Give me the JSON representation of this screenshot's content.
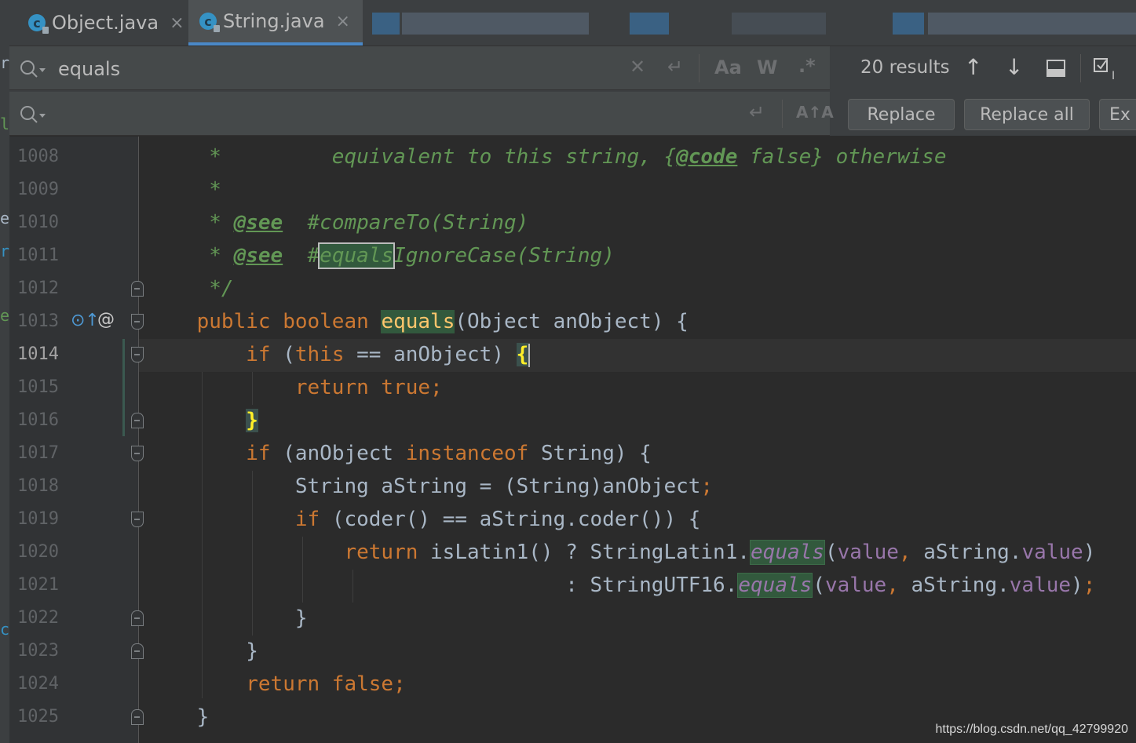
{
  "tabs": [
    {
      "label": "Object.java",
      "active": false
    },
    {
      "label": "String.java",
      "active": true
    }
  ],
  "search": {
    "query": "equals",
    "replace_value": "",
    "results": "20 results",
    "replace_label": "Replace",
    "replace_all_label": "Replace all",
    "exclude_label": "Ex",
    "match_case_label": "Aa",
    "words_label": "W",
    "regex_label": ".*",
    "preserve_case_label": "A↑A"
  },
  "colors": {
    "keyword": "#cc7832",
    "comment": "#629755",
    "field": "#9876aa",
    "match_highlight": "#32593d",
    "method_declaration": "#ffc66d",
    "brace_match": "#ffef28",
    "accent": "#4a88c7"
  },
  "editor": {
    "current_line": "1014",
    "lines": [
      {
        "num": "1008",
        "segments": [
          {
            "t": "     *         equivalent to this string, {",
            "c": "c"
          },
          {
            "t": "@code",
            "c": "tag"
          },
          {
            "t": " false} otherwise",
            "c": "c"
          }
        ]
      },
      {
        "num": "1009",
        "segments": [
          {
            "t": "     *",
            "c": "c"
          }
        ]
      },
      {
        "num": "1010",
        "segments": [
          {
            "t": "     * ",
            "c": "c"
          },
          {
            "t": "@see",
            "c": "tag"
          },
          {
            "t": "  #compareTo(String)",
            "c": "c"
          }
        ]
      },
      {
        "num": "1011",
        "segments": [
          {
            "t": "     * ",
            "c": "c"
          },
          {
            "t": "@see",
            "c": "tag"
          },
          {
            "t": "  #",
            "c": "c"
          },
          {
            "t": "equals",
            "c": "c hl-sel"
          },
          {
            "t": "IgnoreCase(String)",
            "c": "c"
          }
        ]
      },
      {
        "num": "1012",
        "segments": [
          {
            "t": "     */",
            "c": "c"
          }
        ]
      },
      {
        "num": "1013",
        "segments": [
          {
            "t": "    ",
            "c": ""
          },
          {
            "t": "public boolean ",
            "c": "k"
          },
          {
            "t": "equals",
            "c": "hl-fn"
          },
          {
            "t": "(Object anObject) {",
            "c": ""
          }
        ]
      },
      {
        "num": "1014",
        "segments": [
          {
            "t": "        ",
            "c": ""
          },
          {
            "t": "if ",
            "c": "k"
          },
          {
            "t": "(",
            "c": ""
          },
          {
            "t": "this ",
            "c": "k"
          },
          {
            "t": "== anObject) ",
            "c": ""
          },
          {
            "t": "{",
            "c": "brace-match"
          },
          {
            "t": "",
            "c": "caret"
          }
        ]
      },
      {
        "num": "1015",
        "segments": [
          {
            "t": "            ",
            "c": ""
          },
          {
            "t": "return true;",
            "c": "k"
          }
        ]
      },
      {
        "num": "1016",
        "segments": [
          {
            "t": "        ",
            "c": ""
          },
          {
            "t": "}",
            "c": "brace-match"
          }
        ]
      },
      {
        "num": "1017",
        "segments": [
          {
            "t": "        ",
            "c": ""
          },
          {
            "t": "if ",
            "c": "k"
          },
          {
            "t": "(anObject ",
            "c": ""
          },
          {
            "t": "instanceof ",
            "c": "k"
          },
          {
            "t": "String) {",
            "c": ""
          }
        ]
      },
      {
        "num": "1018",
        "segments": [
          {
            "t": "            String aString = (String)anObject",
            "c": ""
          },
          {
            "t": ";",
            "c": "k"
          }
        ]
      },
      {
        "num": "1019",
        "segments": [
          {
            "t": "            ",
            "c": ""
          },
          {
            "t": "if ",
            "c": "k"
          },
          {
            "t": "(coder() == aString.coder()) {",
            "c": ""
          }
        ]
      },
      {
        "num": "1020",
        "segments": [
          {
            "t": "                ",
            "c": ""
          },
          {
            "t": "return ",
            "c": "k"
          },
          {
            "t": "isLatin1() ? StringLatin1.",
            "c": ""
          },
          {
            "t": "equals",
            "c": "s hl"
          },
          {
            "t": "(",
            "c": ""
          },
          {
            "t": "value",
            "c": "f"
          },
          {
            "t": ", ",
            "c": "k"
          },
          {
            "t": "aString.",
            "c": ""
          },
          {
            "t": "value",
            "c": "f"
          },
          {
            "t": ")",
            "c": ""
          }
        ]
      },
      {
        "num": "1021",
        "segments": [
          {
            "t": "                                  : StringUTF16.",
            "c": ""
          },
          {
            "t": "equals",
            "c": "s hl"
          },
          {
            "t": "(",
            "c": ""
          },
          {
            "t": "value",
            "c": "f"
          },
          {
            "t": ", ",
            "c": "k"
          },
          {
            "t": "aString.",
            "c": ""
          },
          {
            "t": "value",
            "c": "f"
          },
          {
            "t": ")",
            "c": ""
          },
          {
            "t": ";",
            "c": "k"
          }
        ]
      },
      {
        "num": "1022",
        "segments": [
          {
            "t": "            }",
            "c": ""
          }
        ]
      },
      {
        "num": "1023",
        "segments": [
          {
            "t": "        }",
            "c": ""
          }
        ]
      },
      {
        "num": "1024",
        "segments": [
          {
            "t": "        ",
            "c": ""
          },
          {
            "t": "return false;",
            "c": "k"
          }
        ]
      },
      {
        "num": "1025",
        "segments": [
          {
            "t": "    }",
            "c": ""
          }
        ]
      }
    ]
  },
  "watermark": "https://blog.csdn.net/qq_42799920"
}
